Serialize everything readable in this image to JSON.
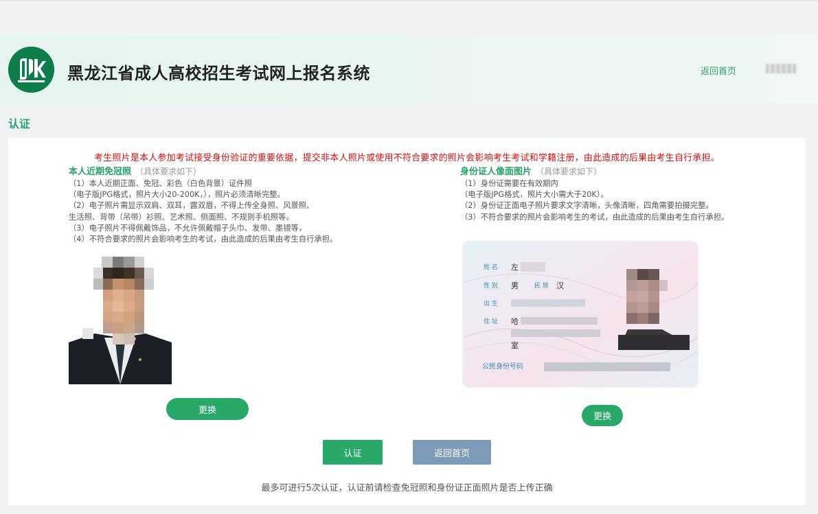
{
  "header": {
    "site_title": "黑龙江省成人高校招生考试网上报名系统",
    "home_link": "返回首页",
    "user_name": "",
    "brand_color": "#0d7d4b"
  },
  "page": {
    "section_title": "认证"
  },
  "warning": "考生照片是本人参加考试接受身份验证的重要依据，提交非本人照片或使用不符合要求的照片会影响考生考试和学籍注册，由此造成的后果由考生自行承担。",
  "left_panel": {
    "title": "本人近期免冠照",
    "note": "（具体要求如下）",
    "lines": [
      "（1）本人近期正面、免冠、彩色（白色背景）证件照",
      "（电子版JPG格式，照片大小20-200K，），照片必须清晰完整。",
      "（2）电子照片需显示双肩、双耳，露双眉，不得上传全身照、风景照、",
      "生活照、背带（吊带）衫照、艺术照、侧面照、不规则手机照等。",
      "（3）电子照片不得佩戴饰品，不允许佩戴帽子头巾、发带、墨镜等，",
      "（4）不符合要求的照片会影响考生的考试，由此造成的后果由考生自行承担。"
    ],
    "change_button": "更换"
  },
  "right_panel": {
    "title": "身份证人像面图片",
    "note": "（具体要求如下）",
    "lines": [
      "（1）身份证需要在有效期内",
      "（电子版JPG格式，照片大小需大于20K）。",
      "（2）身份证正面电子照片要求文字清晰，头像清晰，四角需要拍摄完整。",
      "（3）不符合要求的照片会影响考生的考试，由此造成的后果由考生自行承担。"
    ],
    "change_button": "更换",
    "id_card": {
      "name_label": "姓 名",
      "name_value": "左",
      "sex_label": "性 别",
      "sex_value": "男",
      "ethnicity_label": "民 族",
      "ethnicity_value": "汉",
      "birth_label": "出 生",
      "address_label": "住 址",
      "address_value_1": "哈",
      "address_value_3": "室",
      "id_number_label": "公民身份号码"
    }
  },
  "actions": {
    "verify_button": "认证",
    "back_button": "返回首页"
  },
  "footnote": "最多可进行5次认证，认证前请检查免冠照和身份证正面照片是否上传正确",
  "colors": {
    "accent": "#28a96a",
    "warning": "#d40f0f",
    "secondary_button": "#7d9bb8"
  }
}
